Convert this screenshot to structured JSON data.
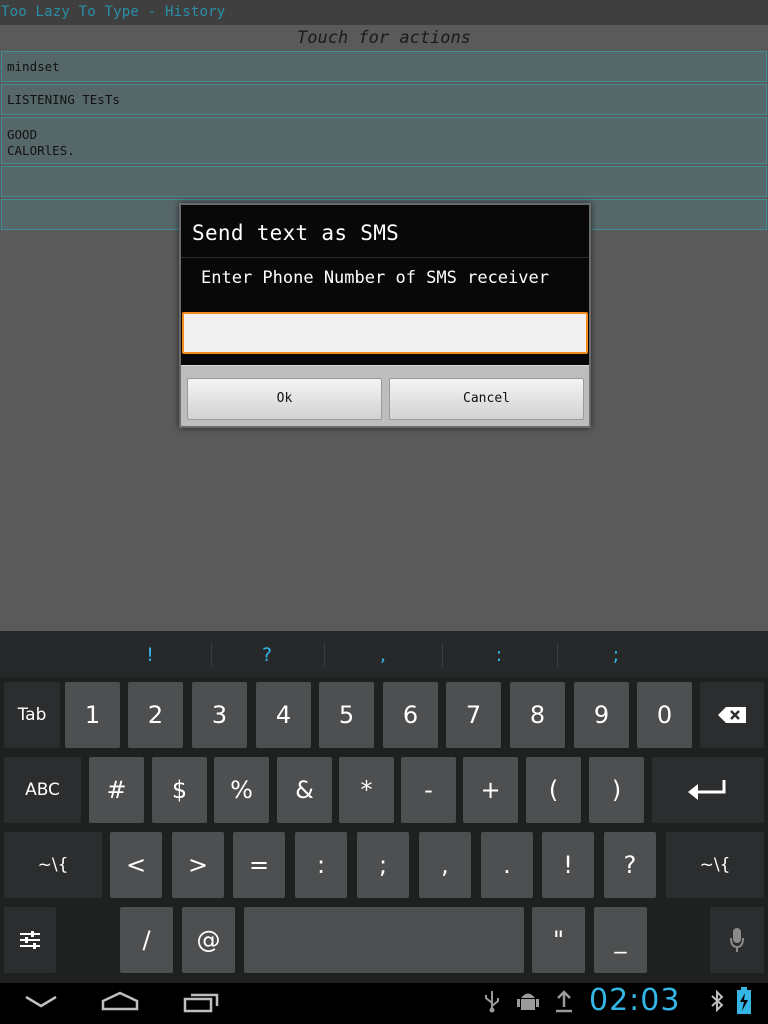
{
  "window": {
    "title": "Too Lazy To Type - History"
  },
  "content": {
    "header": "Touch for actions",
    "history": [
      "mindset",
      "LISTENING TEsTs",
      "GOOD\nCALORlES.",
      "",
      ""
    ]
  },
  "dialog": {
    "title": "Send text as SMS",
    "message": "Enter Phone Number of SMS receiver",
    "input_value": "",
    "ok_label": "Ok",
    "cancel_label": "Cancel"
  },
  "keyboard": {
    "suggestions": [
      "!",
      "?",
      ",",
      ":",
      ";"
    ],
    "row1": {
      "tab": "Tab",
      "keys": [
        "1",
        "2",
        "3",
        "4",
        "5",
        "6",
        "7",
        "8",
        "9",
        "0"
      ]
    },
    "row2": {
      "mode": "ABC",
      "keys": [
        "#",
        "$",
        "%",
        "&",
        "*",
        "-",
        "+",
        "(",
        ")"
      ]
    },
    "row3": {
      "shift_left": "~\\{",
      "keys": [
        "<",
        ">",
        "=",
        ":",
        ";",
        ",",
        ".",
        "!",
        "?"
      ],
      "shift_right": "~\\{"
    },
    "row4": {
      "keys": [
        "/",
        "@"
      ],
      "keys_right": [
        "\"",
        "_"
      ]
    },
    "accent_color": "#33b5e5"
  },
  "status": {
    "clock": "02:03"
  }
}
